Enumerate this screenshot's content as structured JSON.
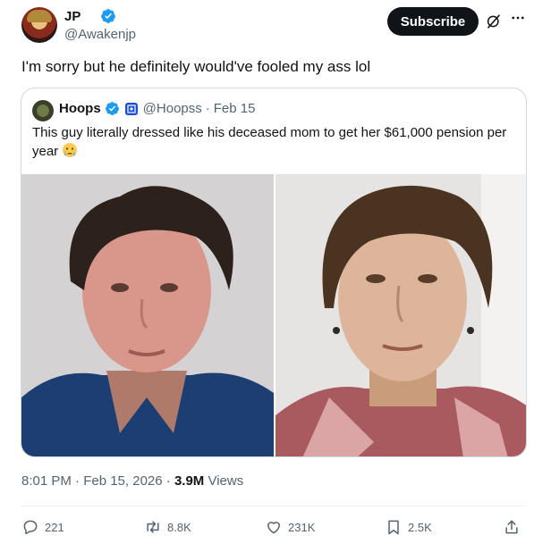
{
  "author": {
    "display_name": "JP",
    "handle": "@Awakenjp"
  },
  "header": {
    "subscribe_label": "Subscribe"
  },
  "tweet": {
    "text": "I'm sorry but he definitely would've fooled my ass lol"
  },
  "quote": {
    "display_name": "Hoops",
    "handle": "@Hoopss",
    "separator": "·",
    "date": "Feb 15",
    "text": "This guy literally dressed like his deceased mom to get her $61,000 pension per year",
    "emoji": "crying-face"
  },
  "meta": {
    "timestamp": "8:01 PM · Feb 15, 2026 · ",
    "views_count": "3.9M",
    "views_label": " Views"
  },
  "actions": {
    "replies": "221",
    "reposts": "8.8K",
    "likes": "231K",
    "bookmarks": "2.5K"
  },
  "colors": {
    "text": "#0f1419",
    "secondary": "#536471",
    "verified": "#1d9bf0",
    "button_bg": "#0f1419"
  }
}
